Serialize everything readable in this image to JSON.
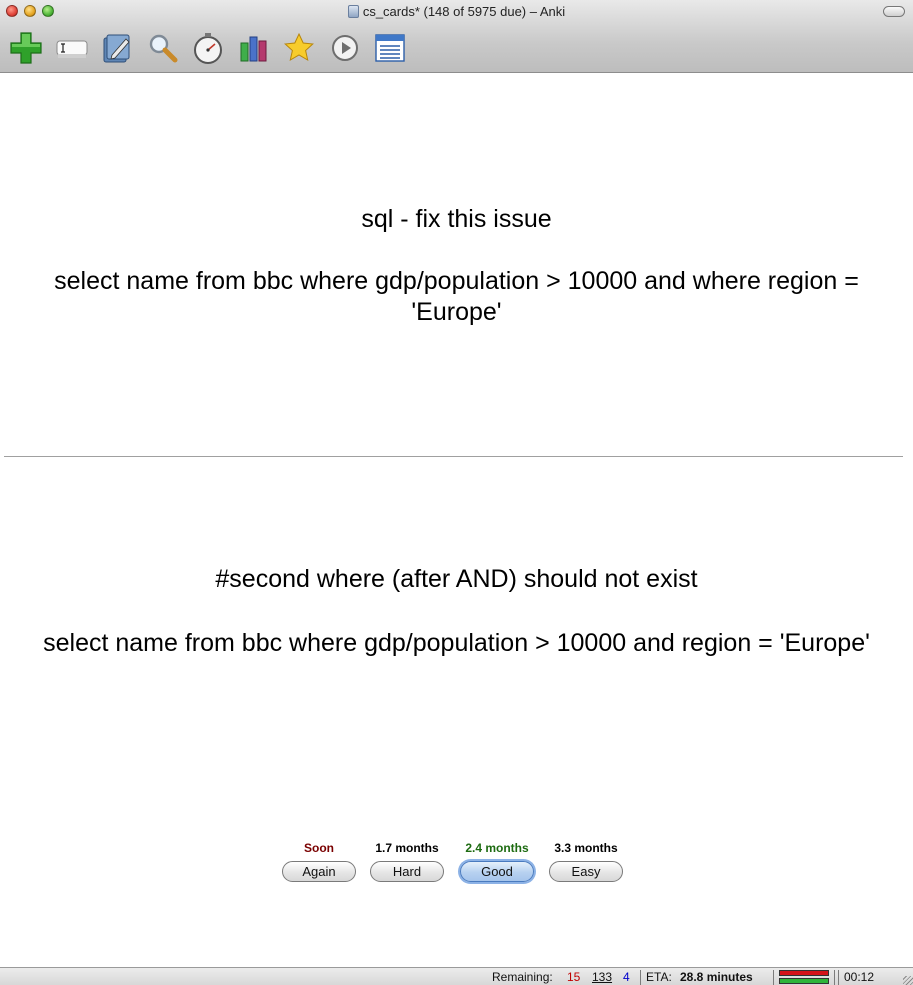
{
  "window": {
    "title": "cs_cards* (148 of 5975 due) – Anki"
  },
  "toolbar": [
    {
      "name": "add-icon"
    },
    {
      "name": "edit-current-icon"
    },
    {
      "name": "edit-deck-icon"
    },
    {
      "name": "browse-search-icon"
    },
    {
      "name": "timer-icon"
    },
    {
      "name": "stats-graph-icon"
    },
    {
      "name": "mark-star-icon"
    },
    {
      "name": "replay-audio-icon"
    },
    {
      "name": "card-list-icon"
    }
  ],
  "card": {
    "question_heading": "sql - fix this issue",
    "question_text": "select name from bbc where gdp/population > 10000 and where region =  'Europe'",
    "answer_heading": "#second where (after AND) should not exist",
    "answer_text": "select name from bbc where gdp/population > 10000 and region = 'Europe'"
  },
  "answers": [
    {
      "interval": "Soon",
      "label": "Again",
      "interval_color": "#7a0000"
    },
    {
      "interval": "1.7 months",
      "label": "Hard",
      "interval_color": "#000000"
    },
    {
      "interval": "2.4 months",
      "label": "Good",
      "interval_color": "#1d6b11"
    },
    {
      "interval": "3.3 months",
      "label": "Easy",
      "interval_color": "#000000"
    }
  ],
  "status": {
    "remaining_label": "Remaining:",
    "remaining_failed": "15",
    "remaining_review": "133",
    "remaining_new": "4",
    "eta_label": "ETA:",
    "eta_value": "28.8 minutes",
    "timer": "00:12",
    "colors": {
      "failed": "#c00000",
      "new": "#0000cc"
    }
  }
}
